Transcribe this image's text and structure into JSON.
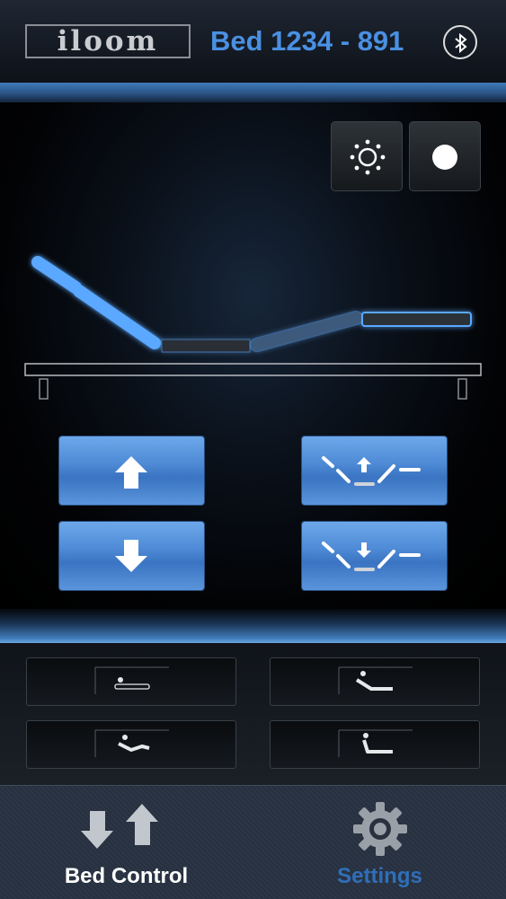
{
  "header": {
    "logo_text": "iloom",
    "bed_title": "Bed 1234 - 891",
    "bluetooth_icon": "bluetooth-icon"
  },
  "controls": {
    "light_icon": "light-icon",
    "dot_icon": "record-dot-icon",
    "up_icon": "arrow-up-icon",
    "down_icon": "arrow-down-icon",
    "flat_up_icon": "bed-raise-icon",
    "flat_down_icon": "bed-lower-icon"
  },
  "presets": [
    "preset-flat-icon",
    "preset-recline-icon",
    "preset-legs-up-icon",
    "preset-sit-icon"
  ],
  "tabs": [
    {
      "label": "Bed Control",
      "icon": "up-down-arrows-icon"
    },
    {
      "label": "Settings",
      "icon": "gear-icon"
    }
  ],
  "colors": {
    "accent": "#4a90e2",
    "bed_glow": "#5aa8ff",
    "button_blue": "#4e8ad6",
    "settings_label": "#2f6fb8"
  }
}
